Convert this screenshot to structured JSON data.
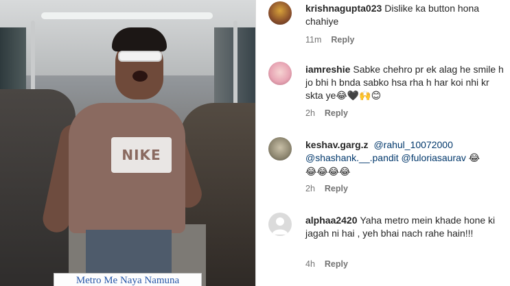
{
  "media": {
    "caption": "Metro Me Naya Namuna",
    "shirt_logo": "NIKE"
  },
  "comments": [
    {
      "username": "krishnagupta023",
      "text": "Dislike ka button hona chahiye",
      "emojis": "",
      "time": "11m",
      "reply_label": "Reply",
      "avatar_icon": "user-avatar-icon"
    },
    {
      "username": "iamreshie",
      "text": "Sabke chehro pr ek alag he smile h jo bhi h bnda sabko hsa rha h har koi nhi kr skta ye",
      "emojis": "😂🖤🙌😊",
      "time": "2h",
      "reply_label": "Reply",
      "avatar_icon": "user-avatar-icon"
    },
    {
      "username": "keshav.garg.z",
      "mentions": [
        "@rahul_10072000",
        "@shashank.__.pandit",
        "@fuloriasaurav"
      ],
      "emojis_inline": "😂",
      "emojis_line": "😂😂😂😂",
      "time": "2h",
      "reply_label": "Reply",
      "avatar_icon": "user-avatar-icon"
    },
    {
      "username": "alphaa2420",
      "text": "Yaha metro mein khade hone ki jagah ni hai , yeh bhai nach rahe hain!!!",
      "emojis": "",
      "time": "4h",
      "reply_label": "Reply",
      "avatar_icon": "default-avatar-icon"
    }
  ],
  "colors": {
    "mention": "#00376b",
    "meta": "#737373",
    "caption": "#2556a8"
  }
}
